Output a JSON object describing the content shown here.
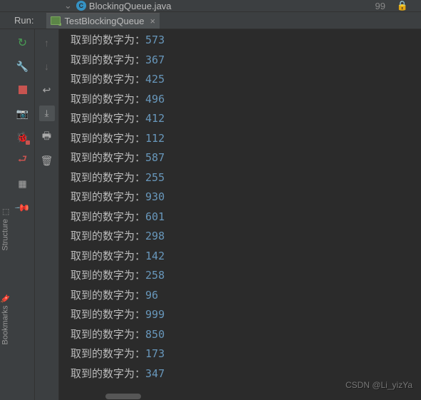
{
  "topbar": {
    "filename": "BlockingQueue.java",
    "line_number": "99"
  },
  "run": {
    "label": "Run:",
    "tab_name": "TestBlockingQueue"
  },
  "sidebar": {
    "structure": "Structure",
    "bookmarks": "Bookmarks"
  },
  "console": {
    "prefix": "取到的数字为：",
    "lines": [
      "573",
      "367",
      "425",
      "496",
      "412",
      "112",
      "587",
      "255",
      "930",
      "601",
      "298",
      "142",
      "258",
      "96",
      "999",
      "850",
      "173",
      "347"
    ]
  },
  "watermark": "CSDN @Li_yizYa"
}
